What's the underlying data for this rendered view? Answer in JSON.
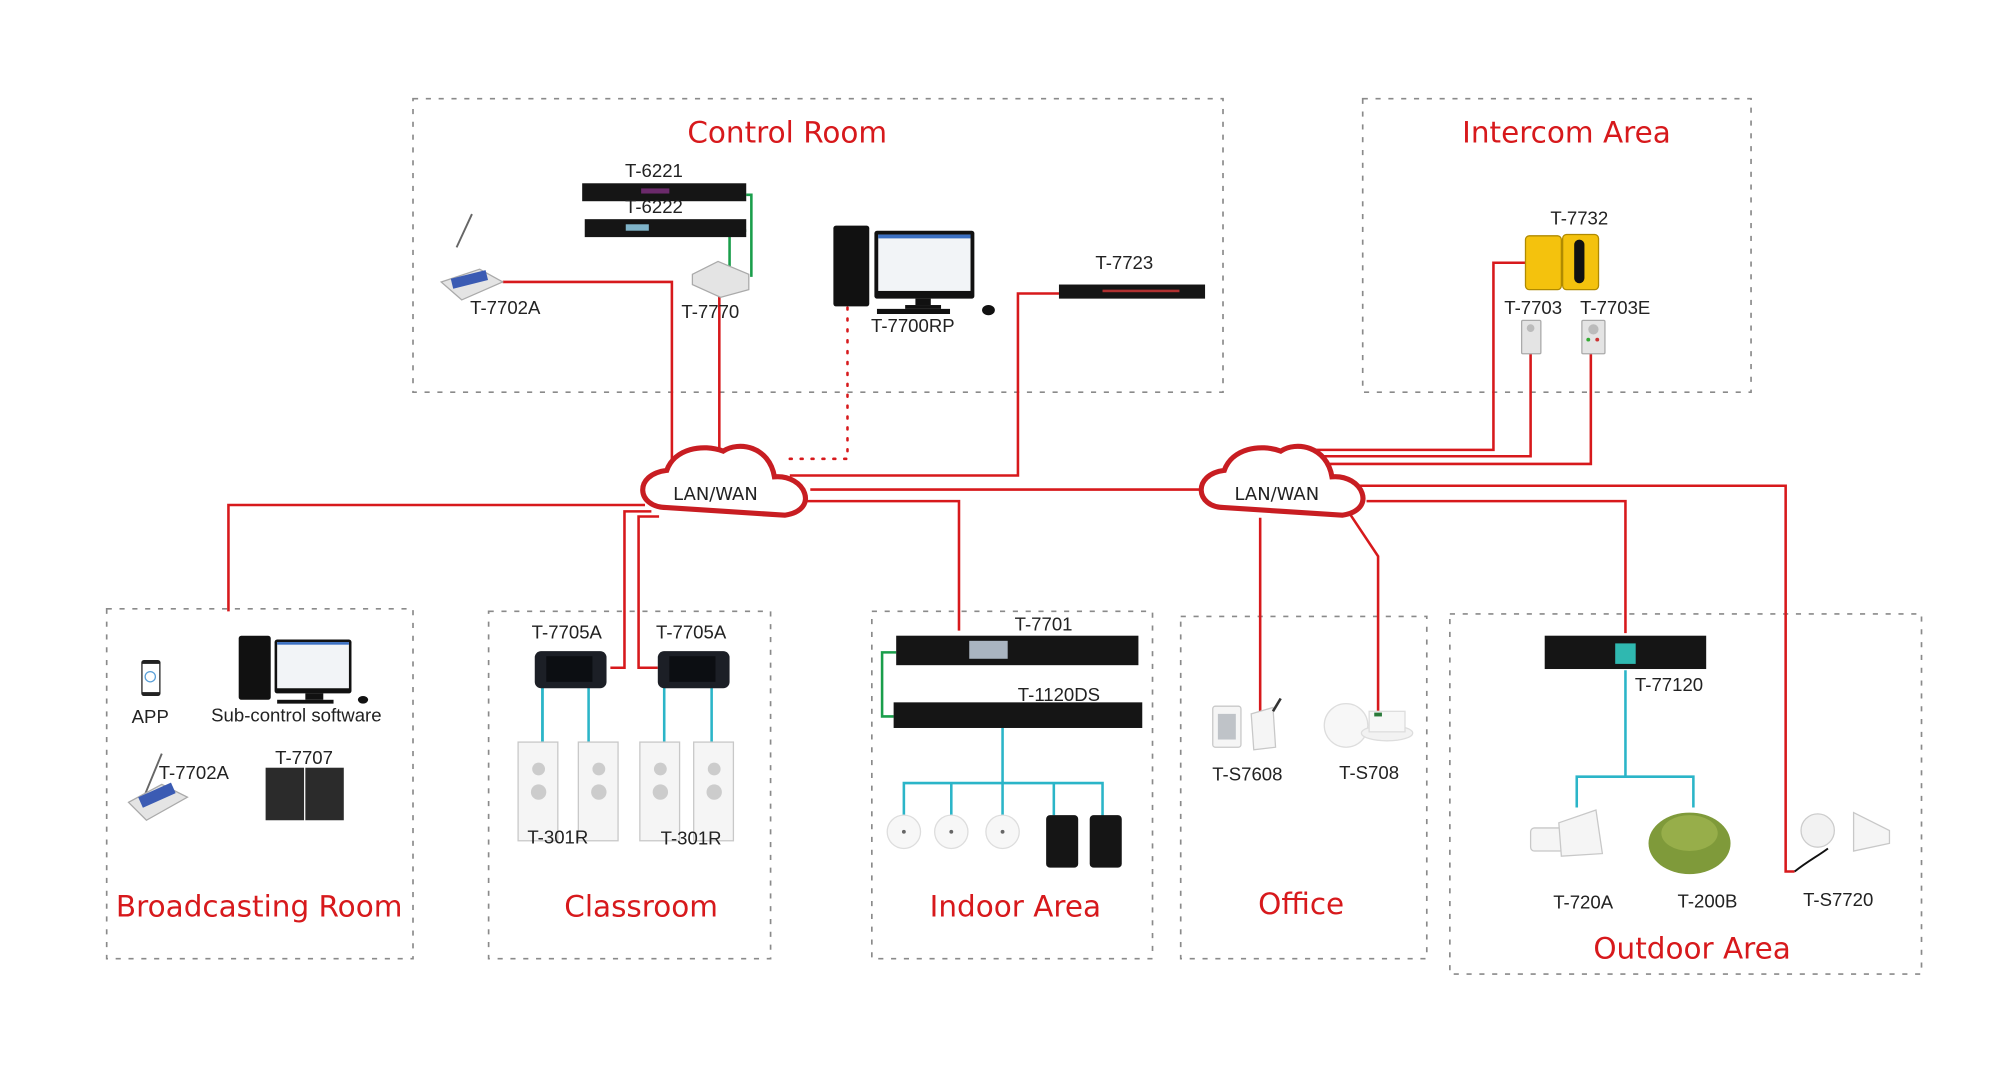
{
  "colors": {
    "zone_title": "#d7191c",
    "network_link": "#d7191c",
    "audio_link_green": "#1a9e4b",
    "speaker_link_cyan": "#2bb5c8",
    "zone_border": "#8a8a8a"
  },
  "clouds": [
    {
      "id": "cloud-left",
      "label": "LAN/WAN"
    },
    {
      "id": "cloud-right",
      "label": "LAN/WAN"
    }
  ],
  "zones": {
    "control_room": {
      "title": "Control Room",
      "devices": {
        "t6221": "T-6221",
        "t6222": "T-6222",
        "t7702a": "T-7702A",
        "t7770": "T-7770",
        "t7700rp": "T-7700RP",
        "t7723": "T-7723"
      }
    },
    "intercom_area": {
      "title": "Intercom Area",
      "devices": {
        "t7732": "T-7732",
        "t7703": "T-7703",
        "t7703e": "T-7703E"
      }
    },
    "broadcasting_room": {
      "title": "Broadcasting Room",
      "devices": {
        "app": "APP",
        "sub_control": "Sub-control software",
        "t7702a": "T-7702A",
        "t7707": "T-7707"
      }
    },
    "classroom": {
      "title": "Classroom",
      "devices": {
        "t7705a_1": "T-7705A",
        "t7705a_2": "T-7705A",
        "t301r_1": "T-301R",
        "t301r_2": "T-301R"
      }
    },
    "indoor_area": {
      "title": "Indoor Area",
      "devices": {
        "t7701": "T-7701",
        "t1120ds": "T-1120DS"
      }
    },
    "office": {
      "title": "Office",
      "devices": {
        "ts7608": "T-S7608",
        "ts708": "T-S708"
      }
    },
    "outdoor_area": {
      "title": "Outdoor Area",
      "devices": {
        "t77120": "T-77120",
        "t720a": "T-720A",
        "t200b": "T-200B",
        "ts7720": "T-S7720"
      }
    }
  }
}
